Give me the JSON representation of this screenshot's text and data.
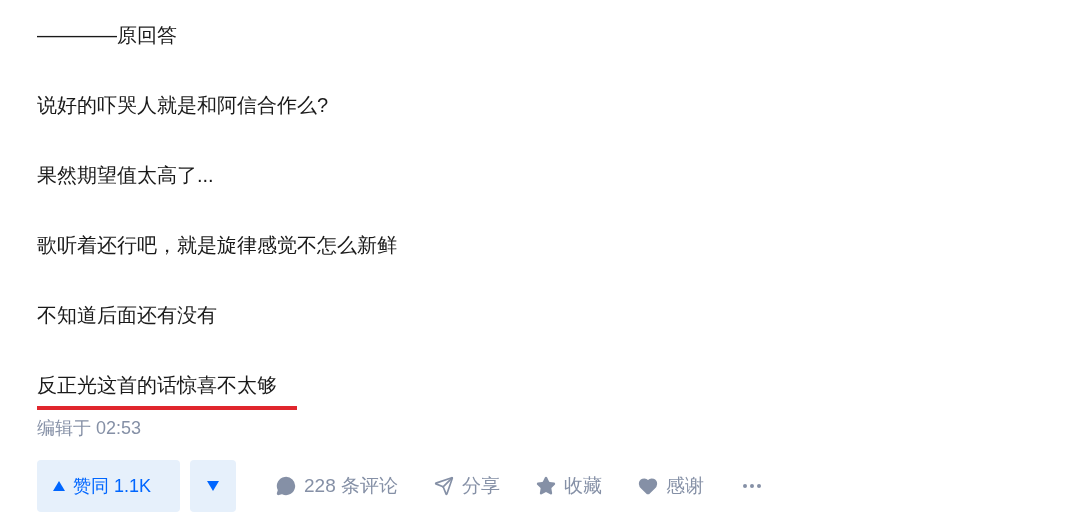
{
  "paragraphs": [
    {
      "text": "————原回答",
      "underlined": false
    },
    {
      "text": "说好的吓哭人就是和阿信合作么?",
      "underlined": false
    },
    {
      "text": "果然期望值太高了...",
      "underlined": false
    },
    {
      "text": "歌听着还行吧，就是旋律感觉不怎么新鲜",
      "underlined": false
    },
    {
      "text": "不知道后面还有没有",
      "underlined": false
    },
    {
      "text": "反正光这首的话惊喜不太够",
      "underlined": true
    }
  ],
  "edited": "编辑于 02:53",
  "vote": {
    "up_label": "赞同 1.1K"
  },
  "actions": [
    {
      "label": "228 条评论"
    },
    {
      "label": "分享"
    },
    {
      "label": "收藏"
    },
    {
      "label": "感谢"
    }
  ]
}
